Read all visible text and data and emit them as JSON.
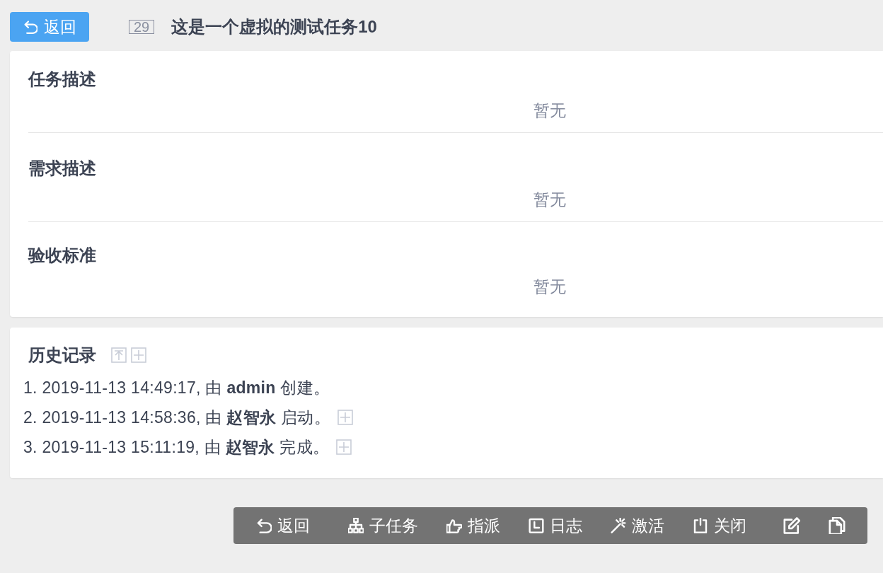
{
  "back_button": {
    "label": "返回"
  },
  "task": {
    "id": "29",
    "title": "这是一个虚拟的测试任务10"
  },
  "sections": [
    {
      "heading": "任务描述",
      "content": "暂无"
    },
    {
      "heading": "需求描述",
      "content": "暂无"
    },
    {
      "heading": "验收标准",
      "content": "暂无"
    }
  ],
  "history": {
    "heading": "历史记录",
    "entries": [
      {
        "text": "1. 2019-11-13 14:49:17, 由 **admin** 创建。",
        "has_details": false
      },
      {
        "text": "2. 2019-11-13 14:58:36, 由 **赵智永** 启动。",
        "has_details": true
      },
      {
        "text": "3. 2019-11-13 15:11:19, 由 **赵智永** 完成。",
        "has_details": true
      }
    ]
  },
  "toolbar": [
    {
      "kind": "back",
      "label": "返回"
    },
    {
      "kind": "subtask",
      "label": "子任务"
    },
    {
      "kind": "assign",
      "label": "指派"
    },
    {
      "kind": "log",
      "label": "日志"
    },
    {
      "kind": "activate",
      "label": "激活"
    },
    {
      "kind": "close",
      "label": "关闭"
    },
    {
      "kind": "edit"
    },
    {
      "kind": "copy"
    }
  ]
}
